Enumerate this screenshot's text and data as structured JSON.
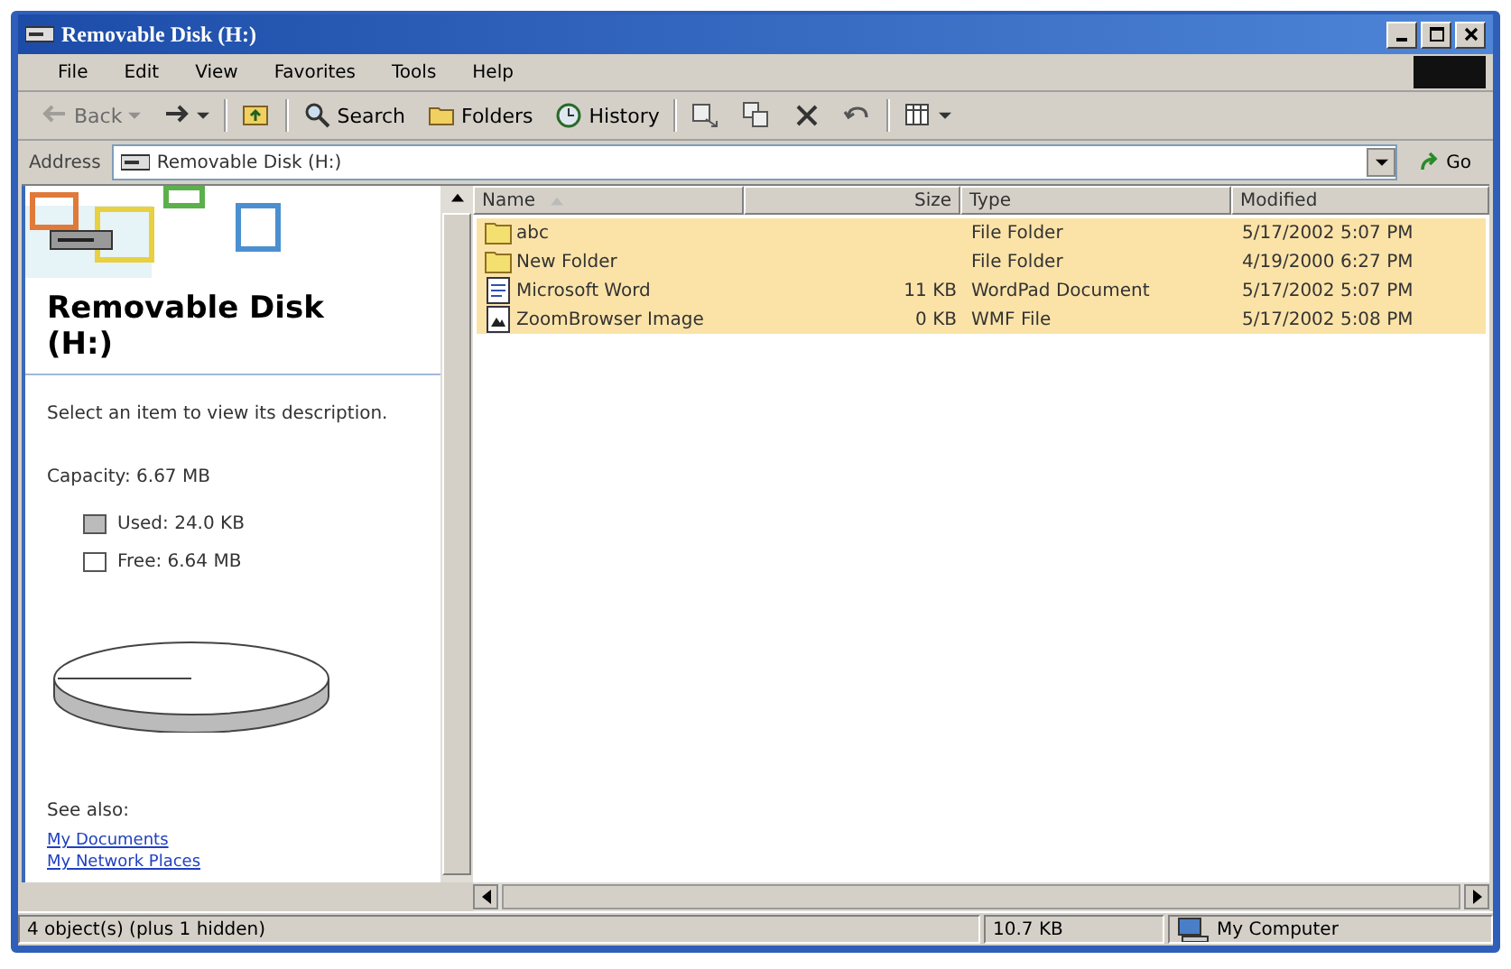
{
  "window": {
    "title": "Removable Disk (H:)"
  },
  "menu": [
    "File",
    "Edit",
    "View",
    "Favorites",
    "Tools",
    "Help"
  ],
  "toolbar": [
    {
      "kind": "back",
      "label": "Back",
      "disabled": true
    },
    {
      "kind": "forward",
      "disabled": false
    },
    {
      "kind": "up",
      "disabled": false
    },
    {
      "kind": "search",
      "label": "Search",
      "disabled": false
    },
    {
      "kind": "folders",
      "label": "Folders",
      "disabled": false
    },
    {
      "kind": "history",
      "label": "History",
      "disabled": false
    },
    {
      "kind": "moveto",
      "disabled": false
    },
    {
      "kind": "copyto",
      "disabled": false
    },
    {
      "kind": "delete",
      "disabled": false
    },
    {
      "kind": "undo",
      "disabled": false
    },
    {
      "kind": "views",
      "disabled": false
    }
  ],
  "address": {
    "label": "Address",
    "value": "Removable Disk (H:)",
    "go": "Go"
  },
  "info_pane": {
    "title": "Removable Disk (H:)",
    "description": "Select an item to view its description.",
    "capacity": "Capacity: 6.67 MB",
    "used": "Used: 24.0 KB",
    "free": "Free: 6.64 MB",
    "see_also": "See also:",
    "links": [
      "My Documents",
      "My Network Places"
    ]
  },
  "table": {
    "columns": [
      "Name",
      "Size",
      "Type",
      "Modified"
    ],
    "rows": [
      {
        "kind": "folder",
        "name": "abc",
        "type": "File Folder",
        "modified": "5/17/2002 5:07 PM",
        "selected": true
      },
      {
        "kind": "folder",
        "name": "New Folder",
        "type": "File Folder",
        "modified": "4/19/2000 6:27 PM",
        "selected": true
      },
      {
        "kind": "document",
        "name": "Microsoft Word",
        "size": "11 KB",
        "type": "WordPad Document",
        "modified": "5/17/2002 5:07 PM",
        "selected": true
      },
      {
        "kind": "image",
        "name": "ZoomBrowser Image",
        "size": "0 KB",
        "type": "WMF File",
        "modified": "5/17/2002 5:08 PM",
        "selected": true
      }
    ]
  },
  "status_bar": {
    "objects": "4 object(s) (plus 1 hidden)",
    "size": "10.7 KB",
    "zone": "My Computer"
  }
}
